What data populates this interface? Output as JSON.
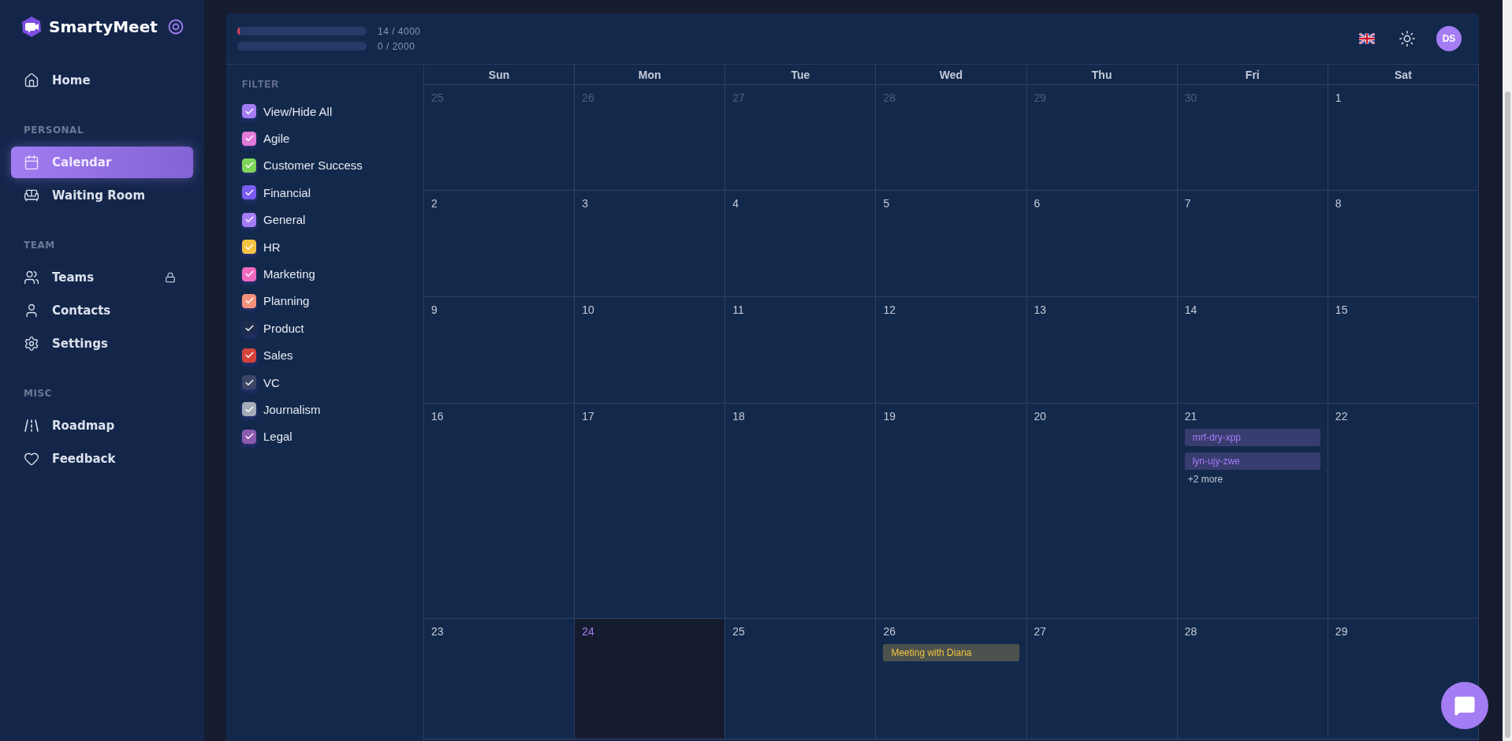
{
  "sidebar": {
    "brand": "SmartyMeet",
    "sections": [
      {
        "items": [
          {
            "label": "Home",
            "selected": false,
            "locked": false
          }
        ]
      },
      {
        "heading": "PERSONAL",
        "items": [
          {
            "label": "Calendar",
            "selected": true,
            "locked": false
          },
          {
            "label": "Waiting Room",
            "selected": false,
            "locked": false
          }
        ]
      },
      {
        "heading": "TEAM",
        "items": [
          {
            "label": "Teams",
            "selected": false,
            "locked": true
          },
          {
            "label": "Contacts",
            "selected": false,
            "locked": false
          },
          {
            "label": "Settings",
            "selected": false,
            "locked": false
          }
        ]
      },
      {
        "heading": "MISC",
        "items": [
          {
            "label": "Roadmap",
            "selected": false,
            "locked": false
          },
          {
            "label": "Feedback",
            "selected": false,
            "locked": false
          }
        ]
      }
    ]
  },
  "header": {
    "usage": [
      {
        "level": 0.004,
        "reading": "14 / 4000"
      },
      {
        "reading": "0 / 2000"
      }
    ],
    "avatar": "DS"
  },
  "filter": {
    "heading": "FILTER",
    "items": [
      {
        "label": "View/Hide All",
        "checked": true,
        "color": "#a47cf3"
      },
      {
        "label": "Agile",
        "checked": true,
        "color": "#e27ad8"
      },
      {
        "label": "Customer Success",
        "checked": true,
        "color": "#7fd45a"
      },
      {
        "label": "Financial",
        "checked": true,
        "color": "#7b5cf0"
      },
      {
        "label": "General",
        "checked": true,
        "color": "#a47cf3"
      },
      {
        "label": "HR",
        "checked": true,
        "color": "#f5c344"
      },
      {
        "label": "Marketing",
        "checked": true,
        "color": "#f06bbf"
      },
      {
        "label": "Planning",
        "checked": true,
        "color": "#f4917c"
      },
      {
        "label": "Product",
        "checked": true,
        "color": "#1d2b4c"
      },
      {
        "label": "Sales",
        "checked": true,
        "color": "#d4433a"
      },
      {
        "label": "VC",
        "checked": true,
        "color": "#3b4666"
      },
      {
        "label": "Journalism",
        "checked": true,
        "color": "#a3abb9"
      },
      {
        "label": "Legal",
        "checked": true,
        "color": "#8b5bb0"
      }
    ]
  },
  "calendar": {
    "weekdays": [
      "Sun",
      "Mon",
      "Tue",
      "Wed",
      "Thu",
      "Fri",
      "Sat"
    ],
    "weeks": [
      {
        "days": [
          {
            "date": "25",
            "muted": true,
            "today": false
          },
          {
            "date": "26",
            "muted": true,
            "today": false
          },
          {
            "date": "27",
            "muted": true,
            "today": false
          },
          {
            "date": "28",
            "muted": true,
            "today": false
          },
          {
            "date": "29",
            "muted": true,
            "today": false
          },
          {
            "date": "30",
            "muted": true,
            "today": false
          },
          {
            "date": "1",
            "muted": false,
            "today": false
          }
        ]
      },
      {
        "days": [
          {
            "date": "2",
            "muted": false,
            "today": false
          },
          {
            "date": "3",
            "muted": false,
            "today": false
          },
          {
            "date": "4",
            "muted": false,
            "today": false
          },
          {
            "date": "5",
            "muted": false,
            "today": false
          },
          {
            "date": "6",
            "muted": false,
            "today": false
          },
          {
            "date": "7",
            "muted": false,
            "today": false
          },
          {
            "date": "8",
            "muted": false,
            "today": false
          }
        ]
      },
      {
        "days": [
          {
            "date": "9",
            "muted": false,
            "today": false
          },
          {
            "date": "10",
            "muted": false,
            "today": false
          },
          {
            "date": "11",
            "muted": false,
            "today": false
          },
          {
            "date": "12",
            "muted": false,
            "today": false
          },
          {
            "date": "13",
            "muted": false,
            "today": false
          },
          {
            "date": "14",
            "muted": false,
            "today": false
          },
          {
            "date": "15",
            "muted": false,
            "today": false
          }
        ]
      },
      {
        "days": [
          {
            "date": "16",
            "muted": false,
            "today": false
          },
          {
            "date": "17",
            "muted": false,
            "today": false
          },
          {
            "date": "18",
            "muted": false,
            "today": false
          },
          {
            "date": "19",
            "muted": false,
            "today": false
          },
          {
            "date": "20",
            "muted": false,
            "today": false
          },
          {
            "date": "21",
            "muted": false,
            "today": false,
            "events": [
              {
                "title": "mrf-dry-xpp",
                "color": "#383c6f"
              },
              {
                "title": "lyn-ujy-zwe",
                "color": "#383c6f"
              }
            ],
            "more": "+2 more"
          },
          {
            "date": "22",
            "muted": false,
            "today": false
          }
        ]
      },
      {
        "days": [
          {
            "date": "23",
            "muted": false,
            "today": false
          },
          {
            "date": "24",
            "muted": false,
            "today": true
          },
          {
            "date": "25",
            "muted": false,
            "today": false
          },
          {
            "date": "26",
            "muted": false,
            "today": false,
            "events": [
              {
                "title": "Meeting with Diana",
                "color": "#4b514c"
              }
            ]
          },
          {
            "date": "27",
            "muted": false,
            "today": false
          },
          {
            "date": "28",
            "muted": false,
            "today": false
          },
          {
            "date": "29",
            "muted": false,
            "today": false
          }
        ]
      }
    ]
  }
}
